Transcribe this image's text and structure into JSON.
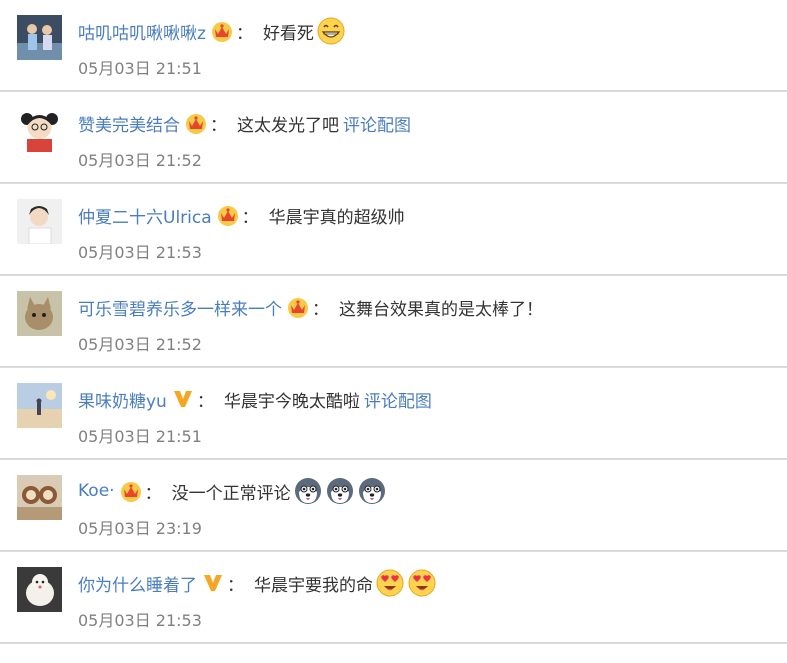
{
  "comments": [
    {
      "username": "咕叽咕叽啾啾啾z",
      "badge": "crown",
      "separator": "：",
      "text": "好看死",
      "link": "",
      "emojis": [
        "grin-emoji"
      ],
      "time": "05月03日 21:51",
      "avatar": "avatar-two-kids"
    },
    {
      "username": "赞美完美结合",
      "badge": "crown",
      "separator": "：",
      "text": "这太发光了吧",
      "link": "评论配图",
      "emojis": [],
      "time": "05月03日 21:52",
      "avatar": "avatar-cartoon-girl"
    },
    {
      "username": "仲夏二十六Ulrica",
      "badge": "crown",
      "separator": "：",
      "text": "华晨宇真的超级帅",
      "link": "",
      "emojis": [],
      "time": "05月03日 21:53",
      "avatar": "avatar-portrait"
    },
    {
      "username": "可乐雪碧养乐多一样来一个",
      "badge": "crown",
      "separator": "：",
      "text": "这舞台效果真的是太棒了！",
      "link": "",
      "emojis": [],
      "time": "05月03日 21:52",
      "avatar": "avatar-cat"
    },
    {
      "username": "果味奶糖yu",
      "badge": "v",
      "separator": "：",
      "text": "华晨宇今晚太酷啦",
      "link": "评论配图",
      "emojis": [],
      "time": "05月03日 21:51",
      "avatar": "avatar-sky"
    },
    {
      "username": "Koe·",
      "badge": "crown",
      "separator": "：",
      "text": "没一个正常评论",
      "link": "",
      "emojis": [
        "husky-emoji",
        "husky-emoji",
        "husky-emoji"
      ],
      "time": "05月03日 23:19",
      "avatar": "avatar-plush"
    },
    {
      "username": "你为什么睡着了",
      "badge": "v",
      "separator": "：",
      "text": "华晨宇要我的命",
      "link": "",
      "emojis": [
        "heart-eyes-emoji",
        "heart-eyes-emoji"
      ],
      "time": "05月03日 21:53",
      "avatar": "avatar-sheep"
    }
  ],
  "colors": {
    "username": "#4a7dbf",
    "text": "#333333",
    "time": "#808080",
    "divider": "#d9d9d9",
    "crown": "#f2b020",
    "v_badge": "#f5a623"
  }
}
